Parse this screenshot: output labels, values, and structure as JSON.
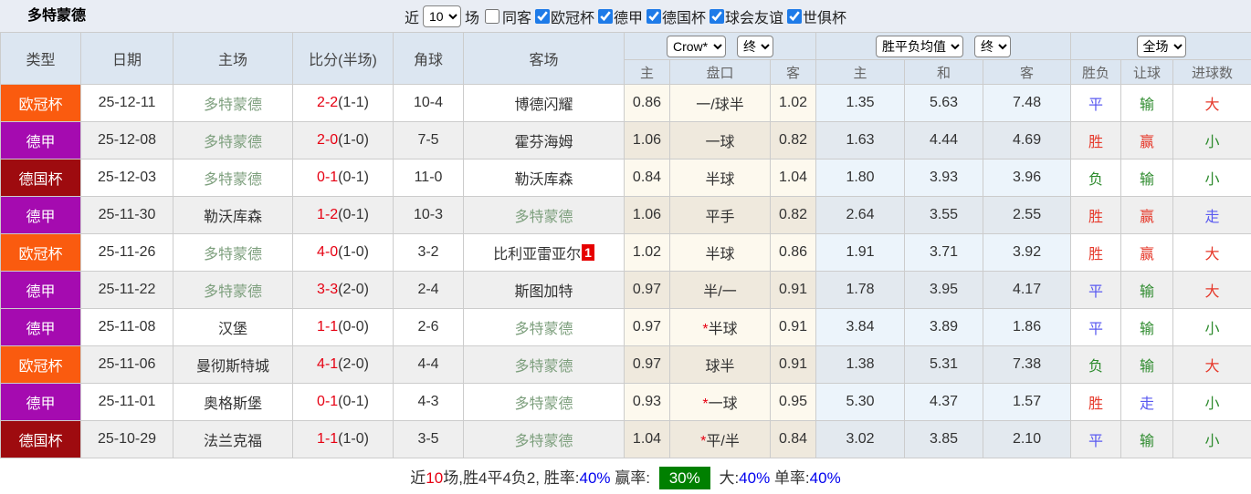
{
  "title": "多特蒙德",
  "filter_bar": {
    "recent_label": "近",
    "recent_value": "10",
    "matches_label": "场",
    "same_away": {
      "label": "同客",
      "checked": false
    },
    "competitions": [
      {
        "label": "欧冠杯",
        "checked": true
      },
      {
        "label": "德甲",
        "checked": true
      },
      {
        "label": "德国杯",
        "checked": true
      },
      {
        "label": "球会友谊",
        "checked": true
      },
      {
        "label": "世俱杯",
        "checked": true
      }
    ]
  },
  "table": {
    "columns_left": [
      "类型",
      "日期",
      "主场",
      "比分(半场)",
      "角球",
      "客场"
    ],
    "group_selects": {
      "odds_company": "Crow*",
      "odds_time": "终",
      "avg_label": "胜平负均值",
      "avg_time": "终",
      "scope": "全场"
    },
    "sub_headers": [
      "主",
      "盘口",
      "客",
      "主",
      "和",
      "客",
      "胜负",
      "让球",
      "进球数"
    ],
    "rows": [
      {
        "type": "欧冠杯",
        "date": "25-12-11",
        "home": "多特蒙德",
        "home_focus": true,
        "score": "2-2",
        "half": "(1-1)",
        "corner": "10-4",
        "away": "博德闪耀",
        "away_focus": false,
        "away_badge": "",
        "odds_home": "0.86",
        "handicap": "一/球半",
        "handicap_star": false,
        "odds_away": "1.02",
        "avg_home": "1.35",
        "avg_draw": "5.63",
        "avg_away": "7.48",
        "outcome": "平",
        "outcome_c": "blue",
        "let": "输",
        "let_c": "green",
        "goal": "大",
        "goal_c": "red"
      },
      {
        "type": "德甲",
        "date": "25-12-08",
        "home": "多特蒙德",
        "home_focus": true,
        "score": "2-0",
        "half": "(1-0)",
        "corner": "7-5",
        "away": "霍芬海姆",
        "away_focus": false,
        "away_badge": "",
        "odds_home": "1.06",
        "handicap": "一球",
        "handicap_star": false,
        "odds_away": "0.82",
        "avg_home": "1.63",
        "avg_draw": "4.44",
        "avg_away": "4.69",
        "outcome": "胜",
        "outcome_c": "red",
        "let": "赢",
        "let_c": "red",
        "goal": "小",
        "goal_c": "green"
      },
      {
        "type": "德国杯",
        "date": "25-12-03",
        "home": "多特蒙德",
        "home_focus": true,
        "score": "0-1",
        "half": "(0-1)",
        "corner": "11-0",
        "away": "勒沃库森",
        "away_focus": false,
        "away_badge": "",
        "odds_home": "0.84",
        "handicap": "半球",
        "handicap_star": false,
        "odds_away": "1.04",
        "avg_home": "1.80",
        "avg_draw": "3.93",
        "avg_away": "3.96",
        "outcome": "负",
        "outcome_c": "green",
        "let": "输",
        "let_c": "green",
        "goal": "小",
        "goal_c": "green"
      },
      {
        "type": "德甲",
        "date": "25-11-30",
        "home": "勒沃库森",
        "home_focus": false,
        "score": "1-2",
        "half": "(0-1)",
        "corner": "10-3",
        "away": "多特蒙德",
        "away_focus": true,
        "away_badge": "",
        "odds_home": "1.06",
        "handicap": "平手",
        "handicap_star": false,
        "odds_away": "0.82",
        "avg_home": "2.64",
        "avg_draw": "3.55",
        "avg_away": "2.55",
        "outcome": "胜",
        "outcome_c": "red",
        "let": "赢",
        "let_c": "red",
        "goal": "走",
        "goal_c": "blue"
      },
      {
        "type": "欧冠杯",
        "date": "25-11-26",
        "home": "多特蒙德",
        "home_focus": true,
        "score": "4-0",
        "half": "(1-0)",
        "corner": "3-2",
        "away": "比利亚雷亚尔",
        "away_focus": false,
        "away_badge": "1",
        "odds_home": "1.02",
        "handicap": "半球",
        "handicap_star": false,
        "odds_away": "0.86",
        "avg_home": "1.91",
        "avg_draw": "3.71",
        "avg_away": "3.92",
        "outcome": "胜",
        "outcome_c": "red",
        "let": "赢",
        "let_c": "red",
        "goal": "大",
        "goal_c": "red"
      },
      {
        "type": "德甲",
        "date": "25-11-22",
        "home": "多特蒙德",
        "home_focus": true,
        "score": "3-3",
        "half": "(2-0)",
        "corner": "2-4",
        "away": "斯图加特",
        "away_focus": false,
        "away_badge": "",
        "odds_home": "0.97",
        "handicap": "半/一",
        "handicap_star": false,
        "odds_away": "0.91",
        "avg_home": "1.78",
        "avg_draw": "3.95",
        "avg_away": "4.17",
        "outcome": "平",
        "outcome_c": "blue",
        "let": "输",
        "let_c": "green",
        "goal": "大",
        "goal_c": "red"
      },
      {
        "type": "德甲",
        "date": "25-11-08",
        "home": "汉堡",
        "home_focus": false,
        "score": "1-1",
        "half": "(0-0)",
        "corner": "2-6",
        "away": "多特蒙德",
        "away_focus": true,
        "away_badge": "",
        "odds_home": "0.97",
        "handicap": "半球",
        "handicap_star": true,
        "odds_away": "0.91",
        "avg_home": "3.84",
        "avg_draw": "3.89",
        "avg_away": "1.86",
        "outcome": "平",
        "outcome_c": "blue",
        "let": "输",
        "let_c": "green",
        "goal": "小",
        "goal_c": "green"
      },
      {
        "type": "欧冠杯",
        "date": "25-11-06",
        "home": "曼彻斯特城",
        "home_focus": false,
        "score": "4-1",
        "half": "(2-0)",
        "corner": "4-4",
        "away": "多特蒙德",
        "away_focus": true,
        "away_badge": "",
        "odds_home": "0.97",
        "handicap": "球半",
        "handicap_star": false,
        "odds_away": "0.91",
        "avg_home": "1.38",
        "avg_draw": "5.31",
        "avg_away": "7.38",
        "outcome": "负",
        "outcome_c": "green",
        "let": "输",
        "let_c": "green",
        "goal": "大",
        "goal_c": "red"
      },
      {
        "type": "德甲",
        "date": "25-11-01",
        "home": "奥格斯堡",
        "home_focus": false,
        "score": "0-1",
        "half": "(0-1)",
        "corner": "4-3",
        "away": "多特蒙德",
        "away_focus": true,
        "away_badge": "",
        "odds_home": "0.93",
        "handicap": "一球",
        "handicap_star": true,
        "odds_away": "0.95",
        "avg_home": "5.30",
        "avg_draw": "4.37",
        "avg_away": "1.57",
        "outcome": "胜",
        "outcome_c": "red",
        "let": "走",
        "let_c": "blue",
        "goal": "小",
        "goal_c": "green"
      },
      {
        "type": "德国杯",
        "date": "25-10-29",
        "home": "法兰克福",
        "home_focus": false,
        "score": "1-1",
        "half": "(1-0)",
        "corner": "3-5",
        "away": "多特蒙德",
        "away_focus": true,
        "away_badge": "",
        "odds_home": "1.04",
        "handicap": "平/半",
        "handicap_star": true,
        "odds_away": "0.84",
        "avg_home": "3.02",
        "avg_draw": "3.85",
        "avg_away": "2.10",
        "outcome": "平",
        "outcome_c": "blue",
        "let": "输",
        "let_c": "green",
        "goal": "小",
        "goal_c": "green"
      }
    ]
  },
  "footer": {
    "parts": [
      {
        "text": "近",
        "style": "plain"
      },
      {
        "text": "10",
        "style": "red"
      },
      {
        "text": "场,胜4平4负2, 胜率:",
        "style": "plain"
      },
      {
        "text": "40%",
        "style": "blue"
      },
      {
        "text": " 赢率: ",
        "style": "plain"
      },
      {
        "text": "30%",
        "style": "highlight"
      },
      {
        "text": " 大:",
        "style": "plain"
      },
      {
        "text": "40%",
        "style": "blue"
      },
      {
        "text": " 单率:",
        "style": "plain"
      },
      {
        "text": "40%",
        "style": "blue"
      }
    ]
  },
  "colors": {
    "topbar_bg": "#e9edf4",
    "header_bg": "#dce6f1",
    "row_alt_bg": "#efefef",
    "handicap_col_bg": "#fdf9ee",
    "avg_col_bg": "#ecf4fb",
    "checkbox_accent": "#1e7be8",
    "focus_team_green": "#7d9f7d",
    "score_red": "#e60012",
    "result_red": "#e6392b",
    "result_green": "#2e8b2e",
    "result_blue": "#5a5af0",
    "link_blue": "#0000ee",
    "win_rate_highlight_bg": "#008000",
    "away_badge_bg": "#e60000",
    "types": {
      "欧冠杯": "#fa5b0f",
      "德甲": "#a50bb0",
      "德国杯": "#9e0b0f"
    }
  }
}
